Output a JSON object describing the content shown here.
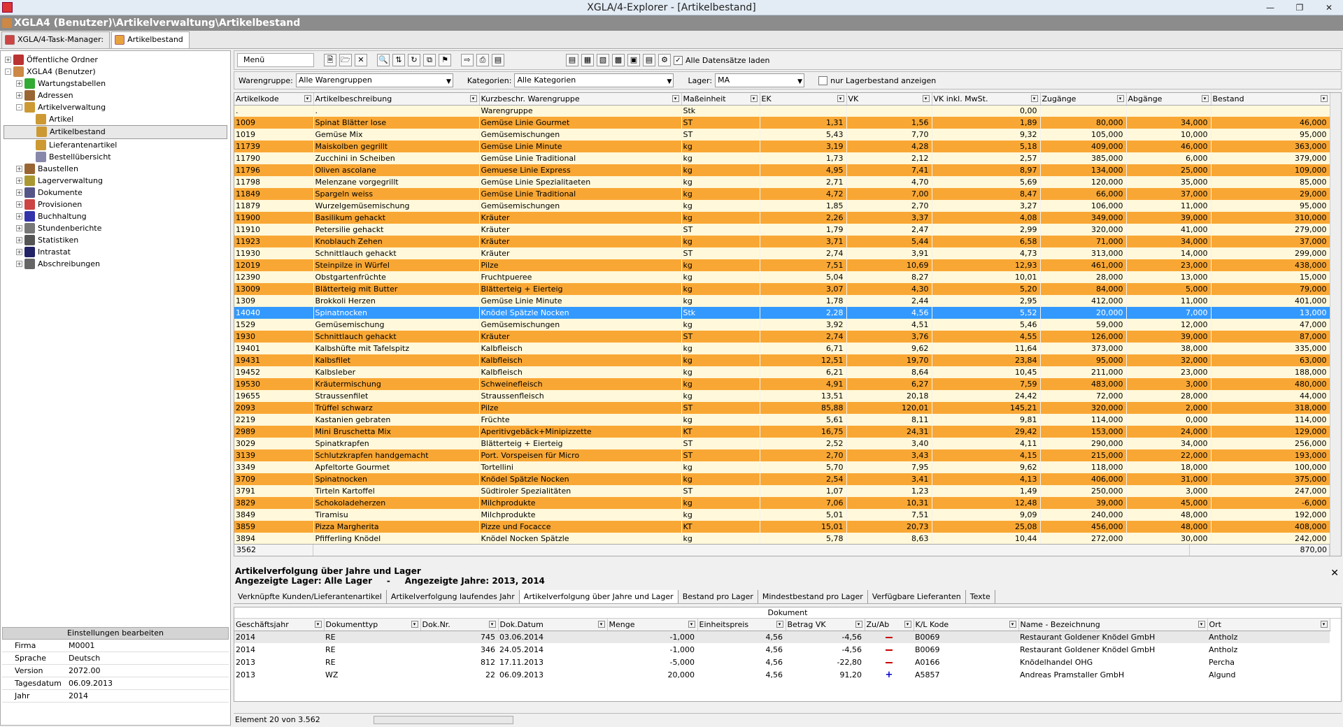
{
  "window": {
    "title": "XGLA/4-Explorer - [Artikelbestand]"
  },
  "path": "XGLA4 (Benutzer)\\Artikelverwaltung\\Artikelbestand",
  "tabs": [
    {
      "label": "XGLA/4-Task-Manager:"
    },
    {
      "label": "Artikelbestand"
    }
  ],
  "tree": [
    {
      "label": "Öffentliche Ordner",
      "level": 0,
      "exp": "+"
    },
    {
      "label": "XGLA4 (Benutzer)",
      "level": 0,
      "exp": "-"
    },
    {
      "label": "Wartungstabellen",
      "level": 1,
      "exp": "+"
    },
    {
      "label": "Adressen",
      "level": 1,
      "exp": "+"
    },
    {
      "label": "Artikelverwaltung",
      "level": 1,
      "exp": "-"
    },
    {
      "label": "Artikel",
      "level": 2,
      "exp": ""
    },
    {
      "label": "Artikelbestand",
      "level": 2,
      "exp": "",
      "selected": true
    },
    {
      "label": "Lieferantenartikel",
      "level": 2,
      "exp": ""
    },
    {
      "label": "Bestellübersicht",
      "level": 2,
      "exp": ""
    },
    {
      "label": "Baustellen",
      "level": 1,
      "exp": "+"
    },
    {
      "label": "Lagerverwaltung",
      "level": 1,
      "exp": "+"
    },
    {
      "label": "Dokumente",
      "level": 1,
      "exp": "+"
    },
    {
      "label": "Provisionen",
      "level": 1,
      "exp": "+"
    },
    {
      "label": "Buchhaltung",
      "level": 1,
      "exp": "+"
    },
    {
      "label": "Stundenberichte",
      "level": 1,
      "exp": "+"
    },
    {
      "label": "Statistiken",
      "level": 1,
      "exp": "+"
    },
    {
      "label": "Intrastat",
      "level": 1,
      "exp": "+"
    },
    {
      "label": "Abschreibungen",
      "level": 1,
      "exp": "+"
    }
  ],
  "settings": {
    "header": "Einstellungen bearbeiten",
    "rows": [
      {
        "k": "Firma",
        "v": "M0001"
      },
      {
        "k": "Sprache",
        "v": "Deutsch"
      },
      {
        "k": "Version",
        "v": "2072.00"
      },
      {
        "k": "Tagesdatum",
        "v": "06.09.2013"
      },
      {
        "k": "Jahr",
        "v": "2014"
      }
    ]
  },
  "toolbar": {
    "menu": "Menü",
    "load_all": "Alle Datensätze laden"
  },
  "filters": {
    "warengruppe_label": "Warengruppe:",
    "warengruppe_value": "Alle Warengruppen",
    "kategorien_label": "Kategorien:",
    "kategorien_value": "Alle Kategorien",
    "lager_label": "Lager:",
    "lager_value": "MA",
    "nur_lager": "nur Lagerbestand anzeigen"
  },
  "grid": {
    "columns": [
      "Artikelkode",
      "Artikelbeschreibung",
      "Kurzbeschr. Warengruppe",
      "Maßeinheit",
      "EK",
      "VK",
      "VK inkl. MwSt.",
      "Zugänge",
      "Abgänge",
      "Bestand"
    ],
    "rows": [
      [
        ".",
        ".",
        "Warengruppe",
        "Stk",
        "",
        "",
        "0,00",
        "",
        "",
        ""
      ],
      [
        "1009",
        "Spinat Blätter lose",
        "Gemüse Linie Gourmet",
        "ST",
        "1,31",
        "1,56",
        "1,89",
        "80,000",
        "34,000",
        "46,000"
      ],
      [
        "1019",
        "Gemüse Mix",
        "Gemüsemischungen",
        "ST",
        "5,43",
        "7,70",
        "9,32",
        "105,000",
        "10,000",
        "95,000"
      ],
      [
        "11739",
        "Maiskolben gegrillt",
        "Gemüse Linie Minute",
        "kg",
        "3,19",
        "4,28",
        "5,18",
        "409,000",
        "46,000",
        "363,000"
      ],
      [
        "11790",
        "Zucchini in Scheiben",
        "Gemüse Linie Traditional",
        "kg",
        "1,73",
        "2,12",
        "2,57",
        "385,000",
        "6,000",
        "379,000"
      ],
      [
        "11796",
        "Oliven ascolane",
        "Gemuese Linie Express",
        "kg",
        "4,95",
        "7,41",
        "8,97",
        "134,000",
        "25,000",
        "109,000"
      ],
      [
        "11798",
        "Melenzane vorgegrillt",
        "Gemüse Linie Spezialitaeten",
        "kg",
        "2,71",
        "4,70",
        "5,69",
        "120,000",
        "35,000",
        "85,000"
      ],
      [
        "11849",
        "Spargeln weiss",
        "Gemüse Linie Traditional",
        "kg",
        "4,72",
        "7,00",
        "8,47",
        "66,000",
        "37,000",
        "29,000"
      ],
      [
        "11879",
        "Wurzelgemüsemischung",
        "Gemüsemischungen",
        "kg",
        "1,85",
        "2,70",
        "3,27",
        "106,000",
        "11,000",
        "95,000"
      ],
      [
        "11900",
        "Basilikum gehackt",
        "Kräuter",
        "kg",
        "2,26",
        "3,37",
        "4,08",
        "349,000",
        "39,000",
        "310,000"
      ],
      [
        "11910",
        "Petersilie gehackt",
        "Kräuter",
        "ST",
        "1,79",
        "2,47",
        "2,99",
        "320,000",
        "41,000",
        "279,000"
      ],
      [
        "11923",
        "Knoblauch Zehen",
        "Kräuter",
        "kg",
        "3,71",
        "5,44",
        "6,58",
        "71,000",
        "34,000",
        "37,000"
      ],
      [
        "11930",
        "Schnittlauch gehackt",
        "Kräuter",
        "ST",
        "2,74",
        "3,91",
        "4,73",
        "313,000",
        "14,000",
        "299,000"
      ],
      [
        "12019",
        "Steinpilze in Würfel",
        "Pilze",
        "kg",
        "7,51",
        "10,69",
        "12,93",
        "461,000",
        "23,000",
        "438,000"
      ],
      [
        "12390",
        "Obstgartenfrüchte",
        "Fruchtpueree",
        "kg",
        "5,04",
        "8,27",
        "10,01",
        "28,000",
        "13,000",
        "15,000"
      ],
      [
        "13009",
        "Blätterteig mit Butter",
        "Blätterteig + Eierteig",
        "kg",
        "3,07",
        "4,30",
        "5,20",
        "84,000",
        "5,000",
        "79,000"
      ],
      [
        "1309",
        "Brokkoli Herzen",
        "Gemüse Linie Minute",
        "kg",
        "1,78",
        "2,44",
        "2,95",
        "412,000",
        "11,000",
        "401,000"
      ],
      [
        "14040",
        "Spinatnocken",
        "Knödel Spätzle Nocken",
        "Stk",
        "2,28",
        "4,56",
        "5,52",
        "20,000",
        "7,000",
        "13,000"
      ],
      [
        "1529",
        "Gemüsemischung",
        "Gemüsemischungen",
        "kg",
        "3,92",
        "4,51",
        "5,46",
        "59,000",
        "12,000",
        "47,000"
      ],
      [
        "1930",
        "Schnittlauch gehackt",
        "Kräuter",
        "ST",
        "2,74",
        "3,76",
        "4,55",
        "126,000",
        "39,000",
        "87,000"
      ],
      [
        "19401",
        "Kalbshüfte mit Tafelspitz",
        "Kalbfleisch",
        "kg",
        "6,71",
        "9,62",
        "11,64",
        "373,000",
        "38,000",
        "335,000"
      ],
      [
        "19431",
        "Kalbsfilet",
        "Kalbfleisch",
        "kg",
        "12,51",
        "19,70",
        "23,84",
        "95,000",
        "32,000",
        "63,000"
      ],
      [
        "19452",
        "Kalbsleber",
        "Kalbfleisch",
        "kg",
        "6,21",
        "8,64",
        "10,45",
        "211,000",
        "23,000",
        "188,000"
      ],
      [
        "19530",
        "Kräutermischung",
        "Schweinefleisch",
        "kg",
        "4,91",
        "6,27",
        "7,59",
        "483,000",
        "3,000",
        "480,000"
      ],
      [
        "19655",
        "Straussenfilet",
        "Straussenfleisch",
        "kg",
        "13,51",
        "20,18",
        "24,42",
        "72,000",
        "28,000",
        "44,000"
      ],
      [
        "2093",
        "Trüffel schwarz",
        "Pilze",
        "ST",
        "85,88",
        "120,01",
        "145,21",
        "320,000",
        "2,000",
        "318,000"
      ],
      [
        "2219",
        "Kastanien gebraten",
        "Früchte",
        "kg",
        "5,61",
        "8,11",
        "9,81",
        "114,000",
        "0,000",
        "114,000"
      ],
      [
        "2989",
        "Mini Bruschetta Mix",
        "Aperitivgebäck+Minipizzette",
        "KT",
        "16,75",
        "24,31",
        "29,42",
        "153,000",
        "24,000",
        "129,000"
      ],
      [
        "3029",
        "Spinatkrapfen",
        "Blätterteig + Eierteig",
        "ST",
        "2,52",
        "3,40",
        "4,11",
        "290,000",
        "34,000",
        "256,000"
      ],
      [
        "3139",
        "Schlutzkrapfen handgemacht",
        "Port. Vorspeisen für Micro",
        "ST",
        "2,70",
        "3,43",
        "4,15",
        "215,000",
        "22,000",
        "193,000"
      ],
      [
        "3349",
        "Apfeltorte Gourmet",
        "Tortellini",
        "kg",
        "5,70",
        "7,95",
        "9,62",
        "118,000",
        "18,000",
        "100,000"
      ],
      [
        "3709",
        "Spinatnocken",
        "Knödel Spätzle Nocken",
        "kg",
        "2,54",
        "3,41",
        "4,13",
        "406,000",
        "31,000",
        "375,000"
      ],
      [
        "3791",
        "Tirteln Kartoffel",
        "Südtiroler Spezialitäten",
        "ST",
        "1,07",
        "1,23",
        "1,49",
        "250,000",
        "3,000",
        "247,000"
      ],
      [
        "3829",
        "Schokoladeherzen",
        "Milchprodukte",
        "kg",
        "7,06",
        "10,31",
        "12,48",
        "39,000",
        "45,000",
        "-6,000"
      ],
      [
        "3849",
        "Tiramisu",
        "Milchprodukte",
        "kg",
        "5,01",
        "7,51",
        "9,09",
        "240,000",
        "48,000",
        "192,000"
      ],
      [
        "3859",
        "Pizza Margherita",
        "Pizze und Focacce",
        "KT",
        "15,01",
        "20,73",
        "25,08",
        "456,000",
        "48,000",
        "408,000"
      ],
      [
        "3894",
        "Pfifferling Knödel",
        "Knödel Nocken Spätzle",
        "kg",
        "5,78",
        "8,63",
        "10,44",
        "272,000",
        "30,000",
        "242,000"
      ]
    ],
    "footer_count": "3562",
    "footer_total": "870,00"
  },
  "detail": {
    "title": "Artikelverfolgung über Jahre und Lager",
    "sub_left": "Angezeigte Lager: Alle Lager",
    "sub_sep": "-",
    "sub_right": "Angezeigte Jahre: 2013,  2014",
    "tabs": [
      "Verknüpfte Kunden/Lieferantenartikel",
      "Artikelverfolgung laufendes Jahr",
      "Artikelverfolgung über Jahre und Lager",
      "Bestand pro Lager",
      "Mindestbestand pro Lager",
      "Verfügbare Lieferanten",
      "Texte"
    ],
    "group_header": "Dokument",
    "columns": [
      "Geschäftsjahr",
      "Dokumenttyp",
      "Dok.Nr.",
      "Dok.Datum",
      "Menge",
      "Einheitspreis",
      "Betrag VK",
      "Zu/Ab",
      "K/L Kode",
      "Name - Bezeichnung",
      "Ort"
    ],
    "rows": [
      [
        "2014",
        "RE",
        "745",
        "03.06.2014",
        "-1,000",
        "4,56",
        "-4,56",
        "minus",
        "B0069",
        "Restaurant Goldener Knödel GmbH",
        "Antholz"
      ],
      [
        "2014",
        "RE",
        "346",
        "24.05.2014",
        "-1,000",
        "4,56",
        "-4,56",
        "minus",
        "B0069",
        "Restaurant Goldener Knödel GmbH",
        "Antholz"
      ],
      [
        "2013",
        "RE",
        "812",
        "17.11.2013",
        "-5,000",
        "4,56",
        "-22,80",
        "minus",
        "A0166",
        "Knödelhandel OHG",
        "Percha"
      ],
      [
        "2013",
        "WZ",
        "22",
        "06.09.2013",
        "20,000",
        "4,56",
        "91,20",
        "plus",
        "A5857",
        "Andreas Pramstaller GmbH",
        "Algund"
      ]
    ]
  },
  "status": "Element 20 von 3.562"
}
